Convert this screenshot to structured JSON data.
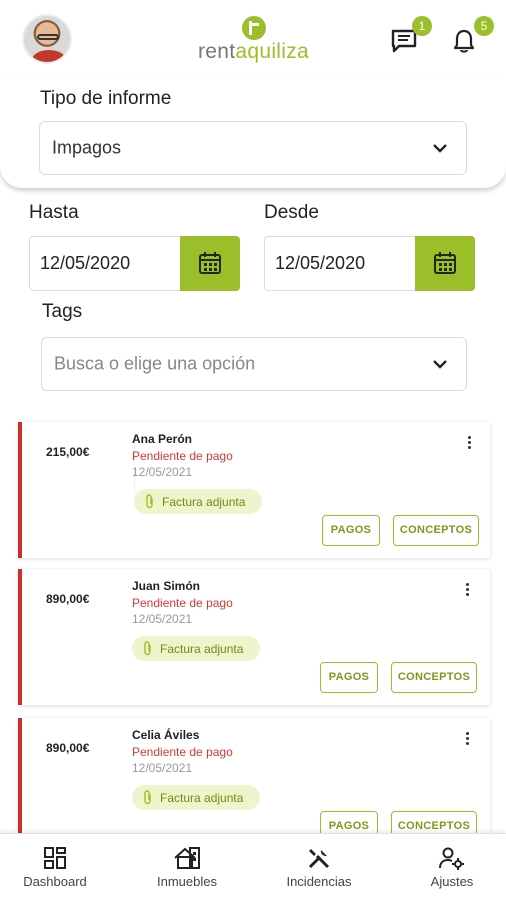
{
  "header": {
    "logo_rent": "rent",
    "logo_aquiliza": "aquiliza",
    "messages_badge": "1",
    "notifications_badge": "5"
  },
  "filters": {
    "report_type_label": "Tipo de informe",
    "report_type_value": "Impagos",
    "hasta_label": "Hasta",
    "hasta_value": "12/05/2020",
    "desde_label": "Desde",
    "desde_value": "12/05/2020",
    "tags_label": "Tags",
    "tags_placeholder": "Busca o elige una opción"
  },
  "cards": [
    {
      "amount": "215,00€",
      "name": "Ana Perón",
      "status": "Pendiente de pago",
      "date": "12/05/2021",
      "attachment": "Factura adjunta",
      "btn_pagos": "PAGOS",
      "btn_conceptos": "CONCEPTOS"
    },
    {
      "amount": "890,00€",
      "name": "Juan Simón",
      "status": "Pendiente de pago",
      "date": "12/05/2021",
      "attachment": "Factura adjunta",
      "btn_pagos": "PAGOS",
      "btn_conceptos": "CONCEPTOS"
    },
    {
      "amount": "890,00€",
      "name": "Celia Áviles",
      "status": "Pendiente de pago",
      "date": "12/05/2021",
      "attachment": "Factura adjunta",
      "btn_pagos": "PAGOS",
      "btn_conceptos": "CONCEPTOS"
    }
  ],
  "nav": [
    {
      "label": "Dashboard",
      "icon": "dashboard-icon"
    },
    {
      "label": "Inmuebles",
      "icon": "building-icon"
    },
    {
      "label": "Incidencias",
      "icon": "tools-icon"
    },
    {
      "label": "Ajustes",
      "icon": "user-settings-icon"
    }
  ],
  "colors": {
    "accent": "#9bbf2a",
    "status_red": "#d13a36",
    "card_border": "#c9302c"
  }
}
